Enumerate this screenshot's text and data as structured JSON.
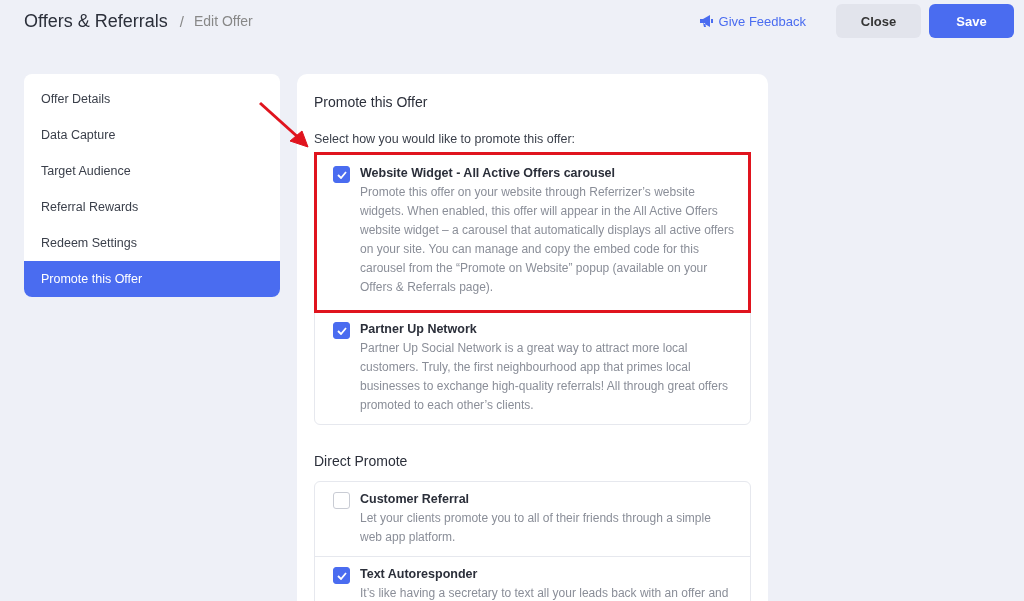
{
  "breadcrumb": {
    "title": "Offers & Referrals",
    "separator": "/",
    "current": "Edit Offer"
  },
  "actions": {
    "feedback": "Give Feedback",
    "close": "Close",
    "save": "Save"
  },
  "sidebar": {
    "items": [
      {
        "label": "Offer Details",
        "selected": false
      },
      {
        "label": "Data Capture",
        "selected": false
      },
      {
        "label": "Target Audience",
        "selected": false
      },
      {
        "label": "Referral Rewards",
        "selected": false
      },
      {
        "label": "Redeem Settings",
        "selected": false
      },
      {
        "label": "Promote this Offer",
        "selected": true
      }
    ]
  },
  "sections": [
    {
      "heading": "Promote this Offer",
      "prompt": "Select how you would like to promote this offer:",
      "options": [
        {
          "title": "Website Widget - All Active Offers carousel",
          "description": "Promote this offer on your website through Referrizer’s website widgets. When enabled, this offer will appear in the All Active Offers website widget – a carousel that automatically displays all active offers on your site. You can manage and copy the embed code for this carousel from the “Promote on Website” popup (available on your Offers & Referrals page).",
          "checked": true,
          "highlighted": true
        },
        {
          "title": "Partner Up Network",
          "description": "Partner Up Social Network is a great way to attract more local customers. Truly, the first neighbourhood app that primes local businesses to exchange high-quality referrals! All through great offers promoted to each other’s clients.",
          "checked": true,
          "highlighted": false
        }
      ]
    },
    {
      "heading": "Direct Promote",
      "options": [
        {
          "title": "Customer Referral",
          "description": "Let your clients promote you to all of their friends through a simple web app platform.",
          "checked": false,
          "highlighted": false
        },
        {
          "title": "Text Autoresponder",
          "description": "It’s like having a secretary to text all your leads back with an offer and",
          "checked": true,
          "highlighted": false
        }
      ]
    }
  ]
}
